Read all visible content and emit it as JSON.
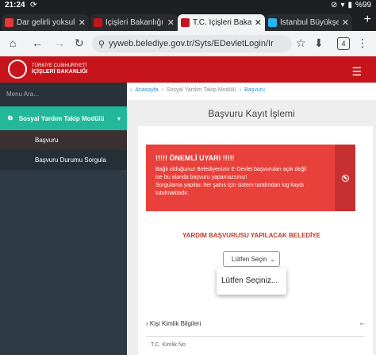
{
  "status_bar": {
    "time": "21:24",
    "sync_icon": "sync-icon",
    "battery": "%99"
  },
  "tabs": [
    {
      "title": "Dar gelirli yoksul",
      "favicon_color": "#e53935",
      "active": false
    },
    {
      "title": "İçişleri Bakanlığı",
      "favicon_color": "#c7141b",
      "active": false
    },
    {
      "title": "T.C. İçişleri Bakan",
      "favicon_color": "#c7141b",
      "active": true
    },
    {
      "title": "İstanbul Büyükşe",
      "favicon_color": "#29b6f6",
      "active": false
    }
  ],
  "browser": {
    "url": "yyweb.belediye.gov.tr/Syts/EDevletLogin/Ir",
    "tab_count": "4",
    "new_tab": "+"
  },
  "site_header": {
    "logo_line1": "TÜRKİYE CUMHURİYETİ",
    "logo_line2": "İÇİŞLERİ BAKANLIĞI",
    "brand_color": "#c7141b"
  },
  "sidebar": {
    "search_placeholder": "Menu Ara...",
    "module_label": "Sosyal Yardım Takip Modülü",
    "items": [
      {
        "label": "Başvuru",
        "active": true
      },
      {
        "label": "Başvuru Durumu Sorgula",
        "active": false
      }
    ],
    "accent_color": "#23b89a"
  },
  "breadcrumb": {
    "home": "Anasayfa",
    "module": "Sosyal Yardım Takip Modülü",
    "current": "Başvuru"
  },
  "page": {
    "title": "Başvuru Kayıt İşlemi"
  },
  "alert": {
    "heading": "!!!!! ÖNEMLİ UYARI !!!!!",
    "line1": "Bağlı olduğunuz Belediyenizin E-Devlet başvuruları açık değil",
    "line2": "ise bu alanda başvuru yapamazsınız!",
    "line3": "Sorgulama yapılan her şahıs için sistem tarafından log kaydı",
    "line4": "tutulmaktadır.",
    "color": "#e8403a"
  },
  "form": {
    "section_label": "YARDIM BAŞVURUSU YAPILACAK BELEDİYE",
    "select_value": "Lütfen Seçin",
    "dropdown_option": "Lütfen Seçiniz..."
  },
  "kimlik": {
    "header": "Kişi Kimlik Bilgileri",
    "tc_label": "T.C. Kimlik No"
  }
}
